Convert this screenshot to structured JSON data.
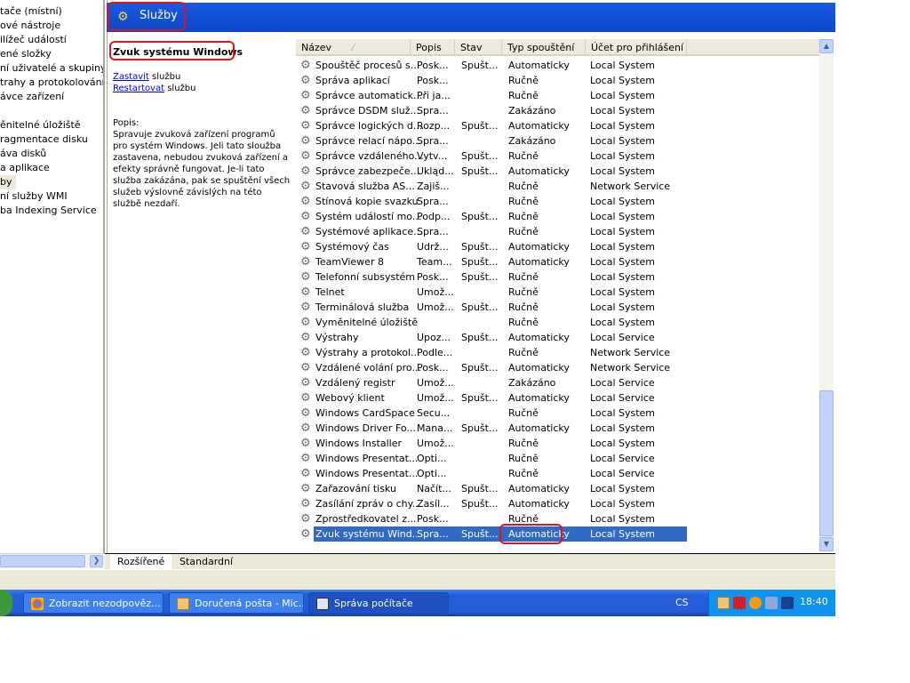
{
  "tree": {
    "items": [
      {
        "label": "tače (místní)"
      },
      {
        "label": "ové nástroje"
      },
      {
        "label": "ilížeč událostí"
      },
      {
        "label": "ené složky"
      },
      {
        "label": "ní uživatelé a skupiny"
      },
      {
        "label": "trahy a protokolování vý"
      },
      {
        "label": "ávce zařízení"
      },
      {
        "label": ""
      },
      {
        "label": "ěnitelné úložiště"
      },
      {
        "label": "ragmentace disku"
      },
      {
        "label": "áva disků"
      },
      {
        "label": "a aplikace"
      },
      {
        "label": "by"
      },
      {
        "label": "ní služby WMI"
      },
      {
        "label": "ba Indexing Service"
      }
    ],
    "selected_index": 12
  },
  "banner": {
    "title": "Služby"
  },
  "details": {
    "service_name": "Zvuk systému Windows",
    "stop_link": "Zastavit",
    "restart_link": "Restartovat",
    "suffix": " službu",
    "desc_label": "Popis:",
    "desc_text": "Spravuje zvuková zařízení programů pro systém Windows. Jeli tato sloužba zastavena, nebudou zvuková zařízení a efekty správně fungovat. Je-li tato služba zakázána, pak se spuštění všech služeb výslovně závislých na této službě nezdaří."
  },
  "columns": [
    "Název",
    "Popis",
    "Stav",
    "Typ spouštění",
    "Účet pro přihlášení"
  ],
  "sort_indicator": "⁄",
  "rows": [
    [
      "Spouštěč procesů s...",
      "Posk...",
      "Spušt...",
      "Automaticky",
      "Local System"
    ],
    [
      "Správa aplikací",
      "Posk...",
      "",
      "Ručně",
      "Local System"
    ],
    [
      "Správce automatick...",
      "Při ja...",
      "",
      "Ručně",
      "Local System"
    ],
    [
      "Správce DSDM služ...",
      "Spra...",
      "",
      "Zakázáno",
      "Local System"
    ],
    [
      "Správce logických d...",
      "Rozp...",
      "Spušt...",
      "Automaticky",
      "Local System"
    ],
    [
      "Správce relací nápo...",
      "Spra...",
      "",
      "Zakázáno",
      "Local System"
    ],
    [
      "Správce vzdáleného...",
      "Vytv...",
      "Spušt...",
      "Ručně",
      "Local System"
    ],
    [
      "Správce zabezpeče...",
      "Ukląd...",
      "Spušt...",
      "Automaticky",
      "Local System"
    ],
    [
      "Stavová služba AS...",
      "Zajiš...",
      "",
      "Ručně",
      "Network Service"
    ],
    [
      "Stínová kopie svazku",
      "Spra...",
      "",
      "Ručně",
      "Local System"
    ],
    [
      "Systém událostí mo...",
      "Podp...",
      "Spušt...",
      "Ručně",
      "Local System"
    ],
    [
      "Systémové aplikace...",
      "Spra...",
      "",
      "Ručně",
      "Local System"
    ],
    [
      "Systémový čas",
      "Udrž...",
      "Spušt...",
      "Automaticky",
      "Local System"
    ],
    [
      "TeamViewer 8",
      "Team...",
      "Spušt...",
      "Automaticky",
      "Local System"
    ],
    [
      "Telefonní subsystém",
      "Posk...",
      "Spušt...",
      "Ručně",
      "Local System"
    ],
    [
      "Telnet",
      "Umož...",
      "",
      "Ručně",
      "Local System"
    ],
    [
      "Terminálová služba",
      "Umož...",
      "Spušt...",
      "Ručně",
      "Local System"
    ],
    [
      "Vyměnitelné úložiště",
      "",
      "",
      "Ručně",
      "Local System"
    ],
    [
      "Výstrahy",
      "Upoz...",
      "Spušt...",
      "Automaticky",
      "Local Service"
    ],
    [
      "Výstrahy a protokol...",
      "Podle...",
      "",
      "Ručně",
      "Network Service"
    ],
    [
      "Vzdálené volání pro...",
      "Posk...",
      "Spušt...",
      "Automaticky",
      "Network Service"
    ],
    [
      "Vzdálený registr",
      "Umož...",
      "",
      "Zakázáno",
      "Local Service"
    ],
    [
      "Webový klient",
      "Umož...",
      "Spušt...",
      "Automaticky",
      "Local Service"
    ],
    [
      "Windows CardSpace",
      "Secu...",
      "",
      "Ručně",
      "Local System"
    ],
    [
      "Windows Driver Fo...",
      "Mana...",
      "Spušt...",
      "Automaticky",
      "Local System"
    ],
    [
      "Windows Installer",
      "Umož...",
      "",
      "Ručně",
      "Local System"
    ],
    [
      "Windows Presentat...",
      "Opti...",
      "",
      "Ručně",
      "Local Service"
    ],
    [
      "Windows Presentat...",
      "Opti...",
      "",
      "Ručně",
      "Local Service"
    ],
    [
      "Zařazování tisku",
      "Načít...",
      "Spušt...",
      "Automaticky",
      "Local System"
    ],
    [
      "Zasílání zpráv o chy...",
      "Zasíl...",
      "Spušt...",
      "Automaticky",
      "Local System"
    ],
    [
      "Zprostředkovatel z...",
      "Posk...",
      "",
      "Ručně",
      "Local System"
    ],
    [
      "Zvuk systému Wind...",
      "Spra...",
      "Spušt...",
      "Automaticky",
      "Local System"
    ]
  ],
  "selected_row": 31,
  "tabs": [
    "Rozšířené",
    "Standardní"
  ],
  "taskbar": {
    "items": [
      "Zobrazit nezodpověz...",
      "Doručená pošta - Mic...",
      "Správa počítače"
    ],
    "language": "CS",
    "clock": "18:40"
  },
  "colors": {
    "accent": "#0b48c8",
    "selection": "#316ac5",
    "highlight": "#e0141b"
  }
}
